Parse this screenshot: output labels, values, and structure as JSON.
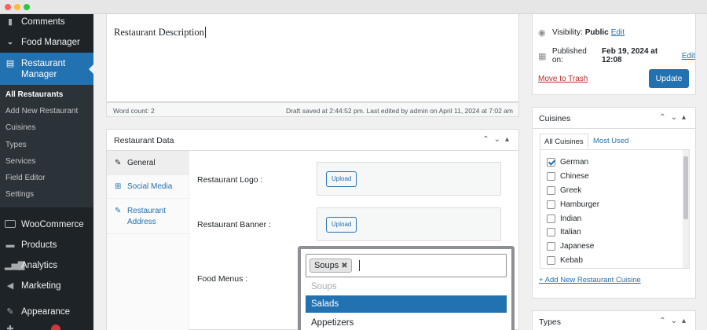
{
  "sidebar": {
    "items": [
      {
        "label": "Comments",
        "icon": "comment-icon"
      },
      {
        "label": "Food Manager",
        "icon": "food-manager-icon"
      },
      {
        "label": "Restaurant Manager",
        "icon": "restaurant-manager-icon"
      },
      {
        "label": "WooCommerce",
        "icon": "woocommerce-icon"
      },
      {
        "label": "Products",
        "icon": "products-icon"
      },
      {
        "label": "Analytics",
        "icon": "analytics-icon"
      },
      {
        "label": "Marketing",
        "icon": "marketing-icon"
      },
      {
        "label": "Appearance",
        "icon": "appearance-icon"
      }
    ],
    "submenu": [
      "All Restaurants",
      "Add New Restaurant",
      "Cuisines",
      "Types",
      "Services",
      "Field Editor",
      "Settings"
    ],
    "accent": "#2271b1"
  },
  "editor": {
    "content": "Restaurant Description",
    "word_count": "Word count: 2",
    "draft_status": "Draft saved at 2:44:52 pm. Last edited by admin on April 11, 2024 at 7:02 am"
  },
  "restaurant_data": {
    "title": "Restaurant Data",
    "tabs": [
      "General",
      "Social Media",
      "Restaurant Address"
    ],
    "fields": {
      "logo_label": "Restaurant Logo :",
      "banner_label": "Restaurant Banner :",
      "menus_label": "Food Menus :",
      "upload_label": "Upload"
    },
    "food_menus": {
      "selected": "Soups",
      "options": [
        "Soups",
        "Salads",
        "Appetizers"
      ],
      "highlighted": "Salads"
    }
  },
  "publish": {
    "visibility_label": "Visibility:",
    "visibility_value": "Public",
    "published_label": "Published on:",
    "published_value": "Feb 19, 2024 at 12:08",
    "edit_label": "Edit",
    "trash_label": "Move to Trash",
    "update_label": "Update"
  },
  "cuisines": {
    "title": "Cuisines",
    "tab_all": "All Cuisines",
    "tab_most_used": "Most Used",
    "items": [
      {
        "label": "German",
        "checked": true
      },
      {
        "label": "Chinese",
        "checked": false
      },
      {
        "label": "Greek",
        "checked": false
      },
      {
        "label": "Hamburger",
        "checked": false
      },
      {
        "label": "Indian",
        "checked": false
      },
      {
        "label": "Italian",
        "checked": false
      },
      {
        "label": "Japanese",
        "checked": false
      },
      {
        "label": "Kebab",
        "checked": false
      }
    ],
    "add_new": "+ Add New Restaurant Cuisine"
  },
  "types": {
    "title": "Types"
  }
}
